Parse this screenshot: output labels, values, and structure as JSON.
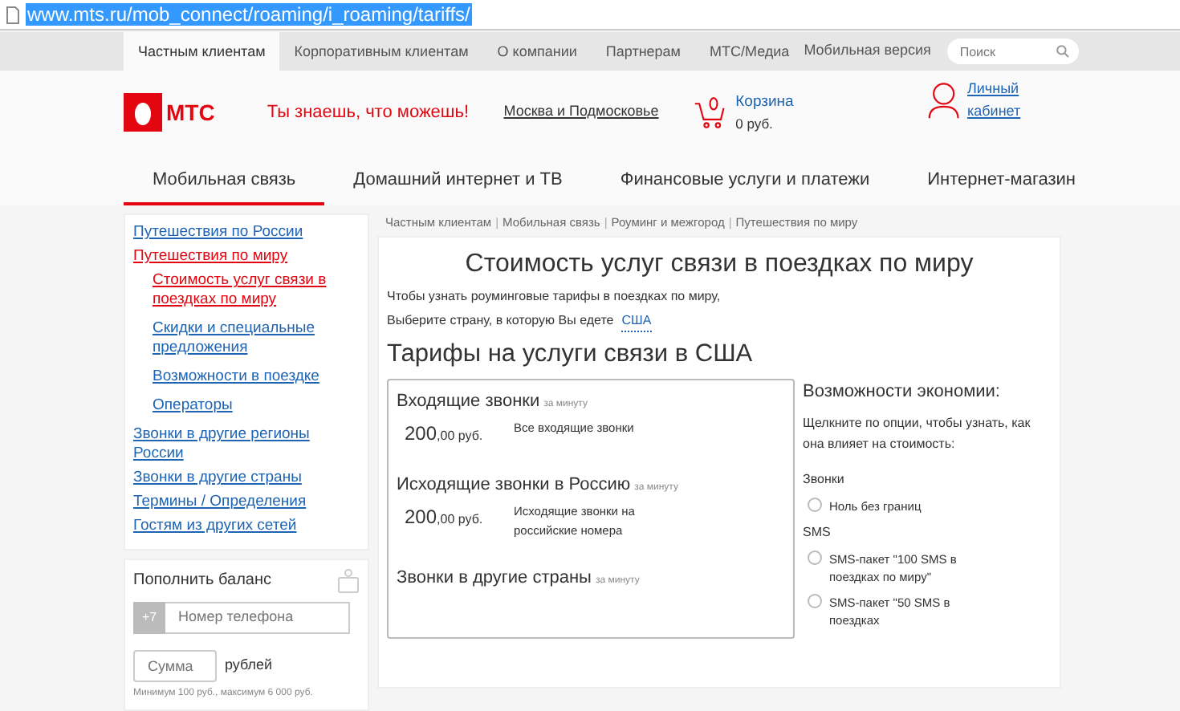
{
  "address_bar": {
    "url": "www.mts.ru/mob_connect/roaming/i_roaming/tariffs/"
  },
  "top_nav": {
    "tabs": [
      {
        "label": "Частным клиентам",
        "selected": true
      },
      {
        "label": "Корпоративным клиентам",
        "selected": false
      },
      {
        "label": "О компании",
        "selected": false
      },
      {
        "label": "Партнерам",
        "selected": false
      },
      {
        "label": "МТС/Медиа",
        "selected": false
      }
    ],
    "mobile_version": "Мобильная версия",
    "search": {
      "placeholder": "Поиск"
    }
  },
  "header": {
    "logo_text": "МТС",
    "slogan": "Ты знаешь, что можешь!",
    "region": "Москва и Подмосковье",
    "cart": {
      "label": "Корзина",
      "amount": "0 руб."
    },
    "account": "Личный кабинет"
  },
  "main_nav": [
    {
      "label": "Мобильная связь",
      "selected": true
    },
    {
      "label": "Домашний интернет и ТВ",
      "selected": false
    },
    {
      "label": "Финансовые услуги и платежи",
      "selected": false
    },
    {
      "label": "Интернет-магазин",
      "selected": false
    }
  ],
  "sidebar": {
    "items": [
      {
        "label": "Путешествия по России",
        "selected": false
      },
      {
        "label": "Путешествия по миру",
        "selected": true,
        "children": [
          {
            "label": "Стоимость услуг связи в поездках по миру",
            "selected": true
          },
          {
            "label": "Скидки и специальные предложения",
            "selected": false
          },
          {
            "label": "Возможности в поездке",
            "selected": false
          },
          {
            "label": "Операторы",
            "selected": false
          }
        ]
      },
      {
        "label": "Звонки в другие регионы России",
        "selected": false
      },
      {
        "label": "Звонки в другие страны",
        "selected": false
      },
      {
        "label": "Термины / Определения",
        "selected": false
      },
      {
        "label": "Гостям из других сетей",
        "selected": false
      }
    ]
  },
  "balance": {
    "title": "Пополнить баланс",
    "prefix": "+7",
    "phone_placeholder": "Номер телефона",
    "amount_placeholder": "Сумма",
    "currency": "рублей",
    "hint": "Минимум 100 руб., максимум 6 000 руб."
  },
  "breadcrumbs": [
    {
      "kind": "link",
      "label": "Частным клиентам"
    },
    {
      "kind": "separator",
      "label": "|"
    },
    {
      "kind": "link",
      "label": "Мобильная связь"
    },
    {
      "kind": "separator",
      "label": "|"
    },
    {
      "kind": "link",
      "label": "Роуминг и межгород"
    },
    {
      "kind": "separator",
      "label": "|"
    },
    {
      "kind": "link",
      "label": "Путешествия по миру"
    }
  ],
  "page": {
    "title": "Стоимость услуг связи в поездках по миру",
    "intro": "Чтобы узнать роуминговые тарифы в поездках по миру,",
    "country_prompt": "Выберите страну, в которую Вы едете",
    "country": "США",
    "section_title": "Тарифы на услуги связи в США"
  },
  "tariffs": [
    {
      "title": "Входящие звонки",
      "unit": "за минуту",
      "price": "200",
      "price_small": ",00 руб.",
      "description": "Все входящие звонки"
    },
    {
      "title": "Исходящие звонки в Россию",
      "unit": "за минуту",
      "price": "200",
      "price_small": ",00 руб.",
      "description": "Исходящие звонки на российские номера"
    },
    {
      "title": "Звонки в другие страны",
      "unit": "за минуту"
    }
  ],
  "savings": {
    "title": "Возможности экономии:",
    "hint": "Щелкните по опции, чтобы узнать, как она влияет на стоимость:",
    "groups": [
      {
        "label": "Звонки",
        "options": [
          {
            "label": "Ноль без границ",
            "checked": false
          }
        ]
      },
      {
        "label": "SMS",
        "options": [
          {
            "label": "SMS-пакет \"100 SMS в поездках по миру\"",
            "checked": false
          },
          {
            "label": "SMS-пакет \"50 SMS в поездках",
            "checked": false
          }
        ]
      }
    ]
  }
}
